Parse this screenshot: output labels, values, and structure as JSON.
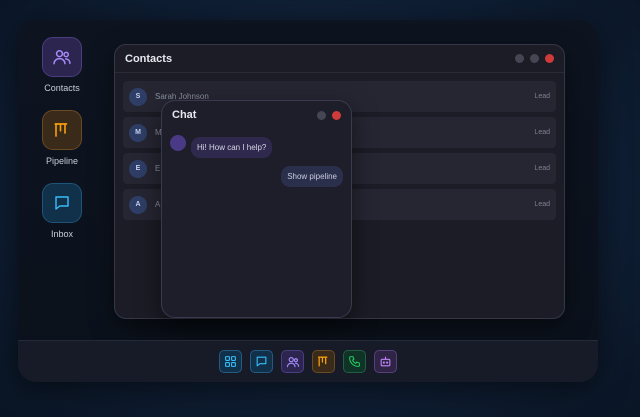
{
  "desktop": {
    "icons": [
      {
        "label": "Contacts",
        "icon": "users-icon",
        "color": "#a78bfa"
      },
      {
        "label": "Pipeline",
        "icon": "pipeline-icon",
        "color": "#f59e0b"
      },
      {
        "label": "Inbox",
        "icon": "message-icon",
        "color": "#38bdf8"
      }
    ]
  },
  "contacts_window": {
    "title": "Contacts",
    "rows": [
      {
        "initial": "S",
        "name": "Sarah Johnson",
        "tag": "Lead"
      },
      {
        "initial": "M",
        "name": "M",
        "tag": "Lead"
      },
      {
        "initial": "E",
        "name": "E",
        "tag": "Lead"
      },
      {
        "initial": "A",
        "name": "A",
        "tag": "Lead"
      }
    ]
  },
  "chat_window": {
    "title": "Chat",
    "incoming": "Hi! How can I help?",
    "outgoing": "Show pipeline"
  },
  "dock": {
    "items": [
      "dashboard-icon",
      "message-icon",
      "users-icon",
      "pipeline-icon",
      "phone-icon",
      "bot-icon"
    ]
  },
  "colors": {
    "close": "#cf3b3b",
    "accent_purple": "#a78bfa",
    "accent_orange": "#f59e0b",
    "accent_blue": "#38bdf8",
    "accent_green": "#22c55e"
  }
}
